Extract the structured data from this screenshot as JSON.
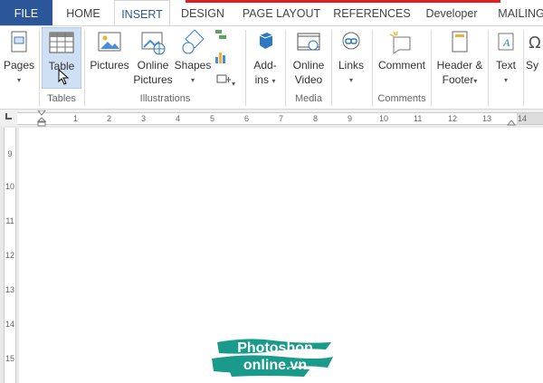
{
  "tabs": {
    "file": "FILE",
    "home": "HOME",
    "insert": "INSERT",
    "design": "DESIGN",
    "page_layout": "PAGE LAYOUT",
    "references": "REFERENCES",
    "developer": "Developer",
    "mailings": "MAILING"
  },
  "ribbon": {
    "pages": "Pages",
    "table": "Table",
    "pictures": "Pictures",
    "online_pictures_1": "Online",
    "online_pictures_2": "Pictures",
    "shapes": "Shapes",
    "addins_1": "Add-",
    "addins_2": "ins",
    "online_video_1": "Online",
    "online_video_2": "Video",
    "links": "Links",
    "comment": "Comment",
    "header_footer_1": "Header &",
    "header_footer_2": "Footer",
    "text": "Text",
    "symbols": "Sy"
  },
  "groups": {
    "tables": "Tables",
    "illustrations": "Illustrations",
    "media": "Media",
    "comments": "Comments"
  },
  "ruler": {
    "h_ticks": [
      "1",
      "2",
      "3",
      "4",
      "5",
      "6",
      "7",
      "8",
      "9",
      "10",
      "11",
      "12",
      "13",
      "14"
    ],
    "v_ticks": [
      "9",
      "10",
      "11",
      "12",
      "13",
      "14",
      "15"
    ]
  },
  "logo": {
    "line1": "Photoshop",
    "line2": "online.vn"
  },
  "colors": {
    "file_tab": "#2b579a",
    "accent_line": "#e02020",
    "selected_button": "#cfe0f4",
    "logo_brush": "#1a9a8a"
  }
}
